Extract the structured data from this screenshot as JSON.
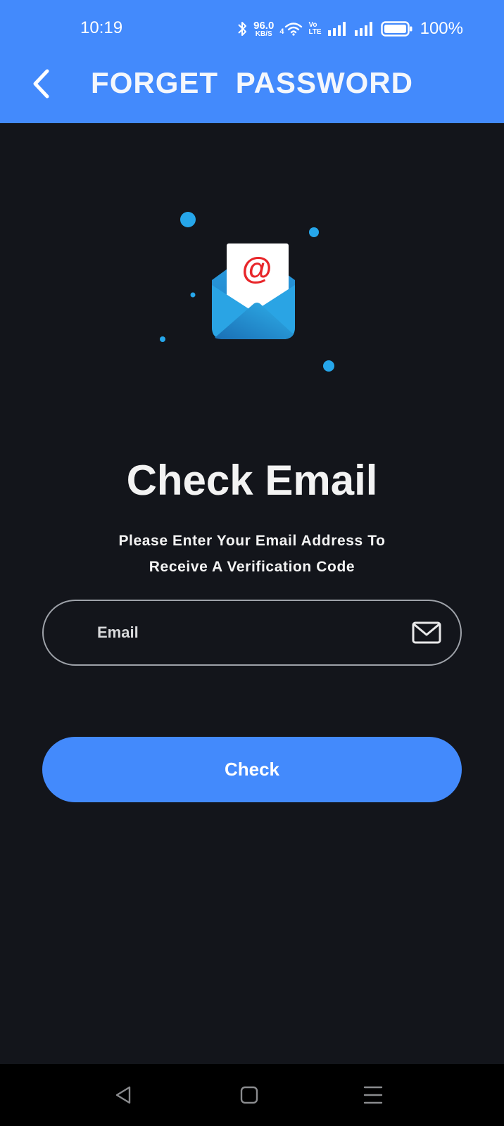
{
  "status_bar": {
    "time": "10:19",
    "net_speed_value": "96.0",
    "net_speed_unit": "KB/S",
    "wifi_label": "4",
    "volte_top": "Vo",
    "volte_bottom": "LTE",
    "battery_percent": "100%"
  },
  "header": {
    "title": "FORGET PASSWORD",
    "back_icon": "chevron-left-icon",
    "background_color": "#438afc"
  },
  "illustration": {
    "icon": "envelope-at-icon",
    "at_symbol": "@"
  },
  "content": {
    "heading": "Check Email",
    "subtitle_line1": "Please Enter Your Email Address To",
    "subtitle_line2": "Receive A Verification Code"
  },
  "email_field": {
    "value": "",
    "placeholder": "Email",
    "icon": "mail-icon"
  },
  "check_button": {
    "label": "Check",
    "color": "#438afc"
  },
  "nav_bar": {
    "back_icon": "triangle-back-icon",
    "home_icon": "square-home-icon",
    "menu_icon": "hamburger-menu-icon"
  }
}
